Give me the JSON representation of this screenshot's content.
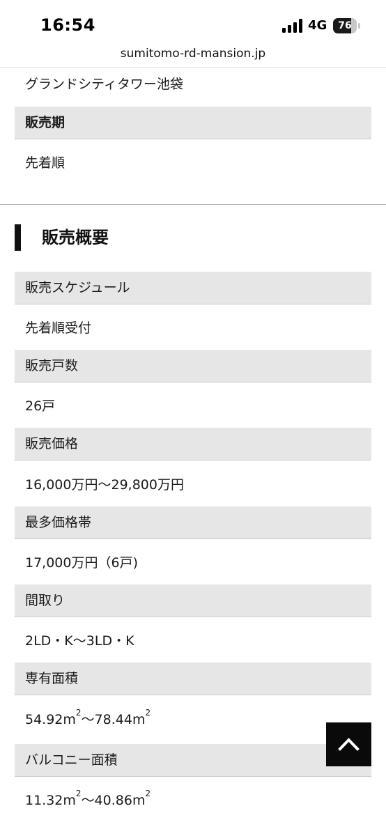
{
  "status_bar": {
    "time": "16:54",
    "network": "4G",
    "battery_level": "76",
    "battery_fraction": 0.76
  },
  "browser": {
    "url": "sumitomo-rd-mansion.jp"
  },
  "top_block": {
    "property_name": "グランドシティタワー池袋",
    "sales_period_label": "販売期",
    "sales_period_value": "先着順"
  },
  "section": {
    "title": "販売概要"
  },
  "rows": [
    {
      "label": "販売スケジュール",
      "value": "先着順受付"
    },
    {
      "label": "販売戸数",
      "value": "26戸"
    },
    {
      "label": "販売価格",
      "value": "16,000万円〜29,800万円"
    },
    {
      "label": "最多価格帯",
      "value": "17,000万円（6戸)"
    },
    {
      "label": "間取り",
      "value": "2LD・K〜3LD・K"
    },
    {
      "label": "専有面積",
      "value_a": "54.92m",
      "sup_a": "2",
      "mid": "〜78.44m",
      "sup_b": "2"
    },
    {
      "label": "バルコニー面積",
      "value_a": "11.32m",
      "sup_a": "2",
      "mid": "〜40.86m",
      "sup_b": "2"
    }
  ],
  "icons": {
    "scroll_top": "chevron-up-icon",
    "signal": "signal-bars-icon",
    "battery": "battery-icon"
  }
}
